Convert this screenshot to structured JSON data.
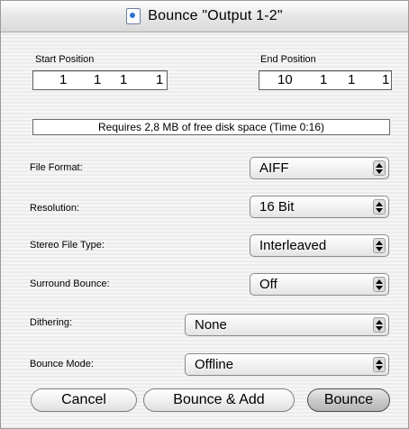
{
  "window": {
    "title": "Bounce \"Output 1-2\"",
    "title_icon": "document-icon"
  },
  "positions": {
    "start_label": "Start Position",
    "start_values": [
      "1",
      "1",
      "1",
      "1"
    ],
    "end_label": "End Position",
    "end_values": [
      "10",
      "1",
      "1",
      "1"
    ]
  },
  "info": {
    "text": "Requires 2,8 MB of free disk space  (Time 0:16)"
  },
  "fields": {
    "file_format": {
      "label": "File Format:",
      "value": "AIFF"
    },
    "resolution": {
      "label": "Resolution:",
      "value": "16 Bit"
    },
    "stereo_file_type": {
      "label": "Stereo File Type:",
      "value": "Interleaved"
    },
    "surround_bounce": {
      "label": "Surround Bounce:",
      "value": "Off"
    },
    "dithering": {
      "label": "Dithering:",
      "value": "None"
    },
    "bounce_mode": {
      "label": "Bounce Mode:",
      "value": "Offline"
    }
  },
  "buttons": {
    "cancel": "Cancel",
    "bounce_add": "Bounce & Add",
    "bounce": "Bounce"
  }
}
